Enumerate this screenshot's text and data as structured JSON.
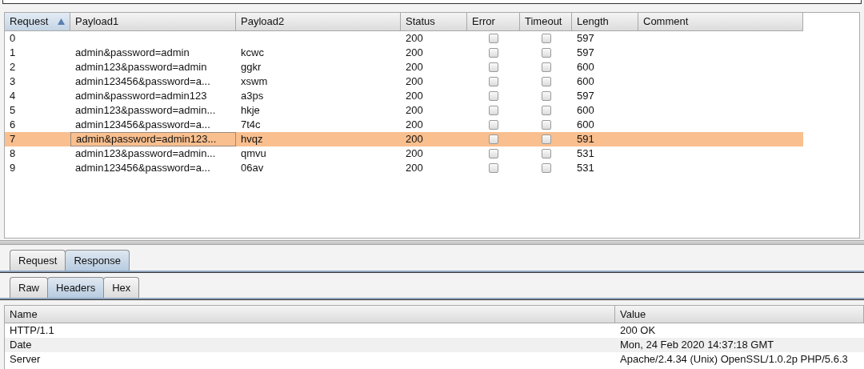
{
  "results_table": {
    "columns": [
      {
        "label": "Request",
        "sorted": true
      },
      {
        "label": "Payload1",
        "sorted": false
      },
      {
        "label": "Payload2",
        "sorted": false
      },
      {
        "label": "Status",
        "sorted": false
      },
      {
        "label": "Error",
        "sorted": false
      },
      {
        "label": "Timeout",
        "sorted": false
      },
      {
        "label": "Length",
        "sorted": false
      },
      {
        "label": "Comment",
        "sorted": false
      }
    ],
    "rows": [
      {
        "request": "0",
        "payload1": "",
        "payload2": "",
        "status": "200",
        "error": false,
        "timeout": false,
        "length": "597",
        "selected": false
      },
      {
        "request": "1",
        "payload1": "admin&password=admin",
        "payload2": "kcwc",
        "status": "200",
        "error": false,
        "timeout": false,
        "length": "597",
        "selected": false
      },
      {
        "request": "2",
        "payload1": "admin123&password=admin",
        "payload2": "ggkr",
        "status": "200",
        "error": false,
        "timeout": false,
        "length": "600",
        "selected": false
      },
      {
        "request": "3",
        "payload1": "admin123456&password=a...",
        "payload2": "xswm",
        "status": "200",
        "error": false,
        "timeout": false,
        "length": "600",
        "selected": false
      },
      {
        "request": "4",
        "payload1": "admin&password=admin123",
        "payload2": "a3ps",
        "status": "200",
        "error": false,
        "timeout": false,
        "length": "597",
        "selected": false
      },
      {
        "request": "5",
        "payload1": "admin123&password=admin...",
        "payload2": "hkje",
        "status": "200",
        "error": false,
        "timeout": false,
        "length": "600",
        "selected": false
      },
      {
        "request": "6",
        "payload1": "admin123456&password=a...",
        "payload2": "7t4c",
        "status": "200",
        "error": false,
        "timeout": false,
        "length": "600",
        "selected": false
      },
      {
        "request": "7",
        "payload1": "admin&password=admin123...",
        "payload2": "hvqz",
        "status": "200",
        "error": false,
        "timeout": false,
        "length": "591",
        "selected": true
      },
      {
        "request": "8",
        "payload1": "admin123&password=admin...",
        "payload2": "qmvu",
        "status": "200",
        "error": false,
        "timeout": false,
        "length": "531",
        "selected": false
      },
      {
        "request": "9",
        "payload1": "admin123456&password=a...",
        "payload2": "06av",
        "status": "200",
        "error": false,
        "timeout": false,
        "length": "531",
        "selected": false
      }
    ]
  },
  "message_tabs": [
    {
      "label": "Request",
      "selected": false
    },
    {
      "label": "Response",
      "selected": true
    }
  ],
  "view_tabs": [
    {
      "label": "Raw",
      "selected": false
    },
    {
      "label": "Headers",
      "selected": true
    },
    {
      "label": "Hex",
      "selected": false
    }
  ],
  "headers_table": {
    "columns": [
      "Name",
      "Value"
    ],
    "rows": [
      {
        "name": "HTTP/1.1",
        "value": "200 OK"
      },
      {
        "name": "Date",
        "value": "Mon, 24 Feb 2020 14:37:18 GMT"
      },
      {
        "name": "Server",
        "value": "Apache/2.4.34 (Unix) OpenSSL/1.0.2p PHP/5.6.3"
      }
    ]
  }
}
